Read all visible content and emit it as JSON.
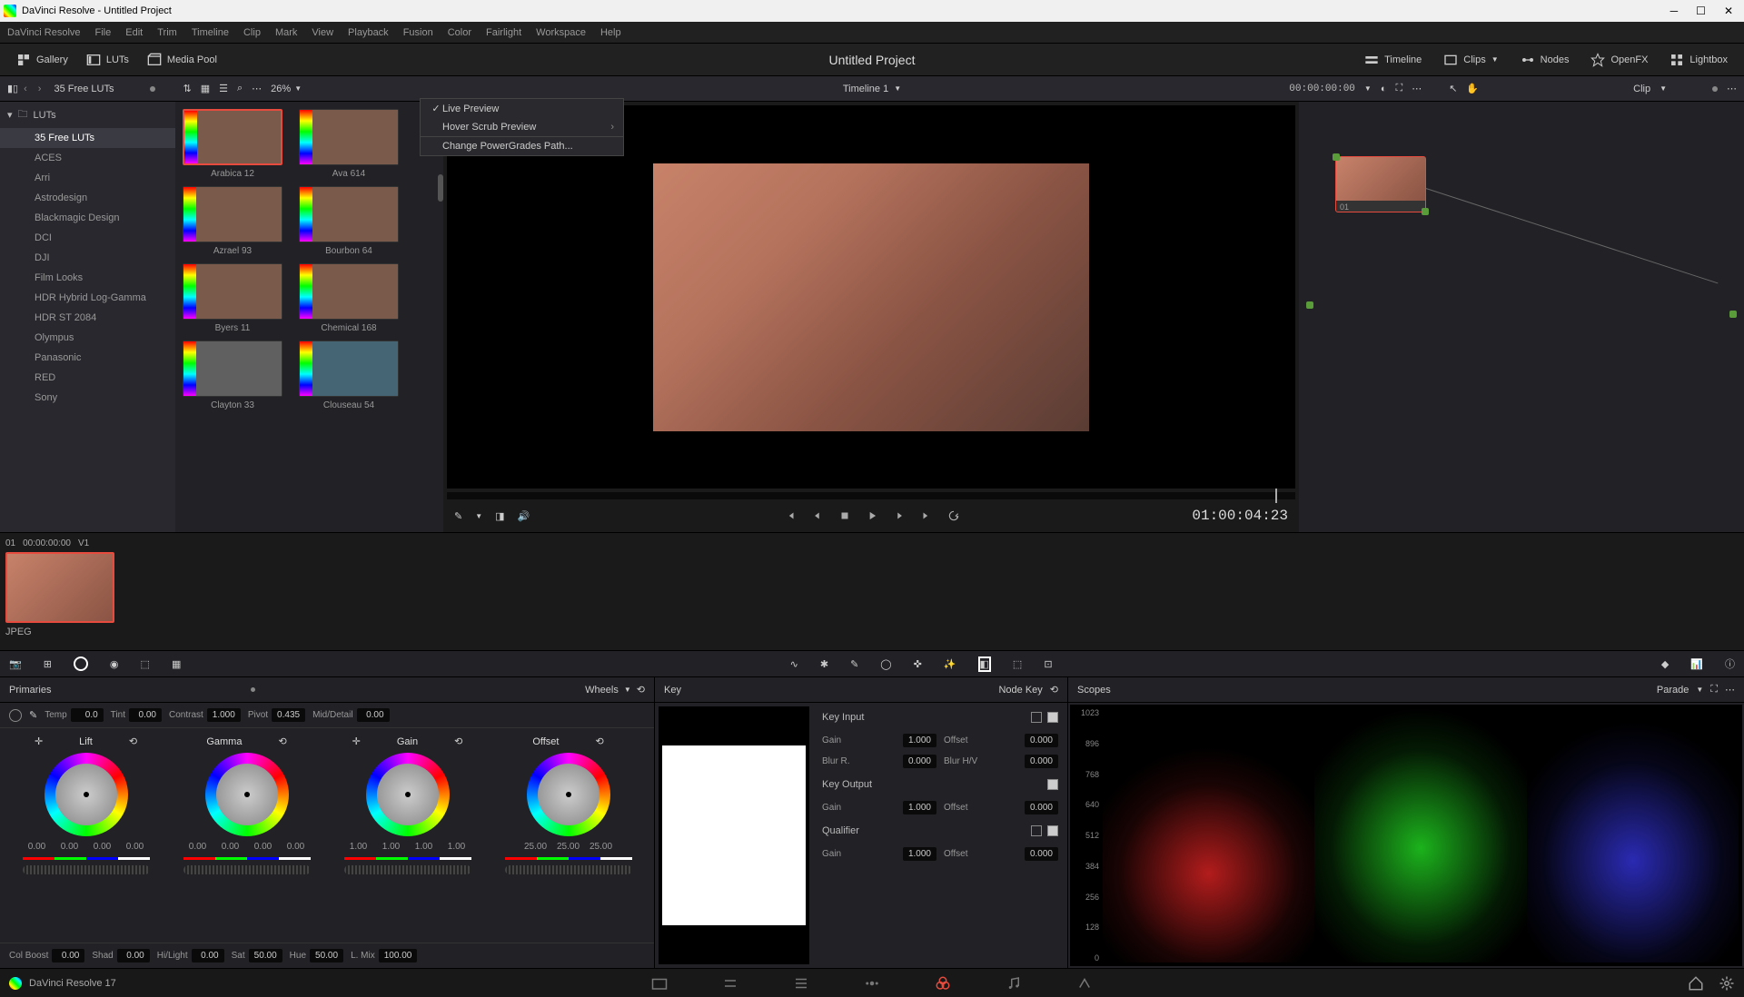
{
  "titlebar": {
    "app": "DaVinci Resolve",
    "project": "Untitled Project",
    "full": "DaVinci Resolve - Untitled Project"
  },
  "menubar": [
    "DaVinci Resolve",
    "File",
    "Edit",
    "Trim",
    "Timeline",
    "Clip",
    "Mark",
    "View",
    "Playback",
    "Fusion",
    "Color",
    "Fairlight",
    "Workspace",
    "Help"
  ],
  "toolbar": {
    "gallery": "Gallery",
    "luts": "LUTs",
    "mediapool": "Media Pool",
    "title": "Untitled Project",
    "timeline": "Timeline",
    "clips": "Clips",
    "nodes": "Nodes",
    "openfx": "OpenFX",
    "lightbox": "Lightbox"
  },
  "subtoolbar": {
    "path": "35 Free LUTs",
    "zoom": "26%",
    "timeline_name": "Timeline 1",
    "timecode": "00:00:00:00",
    "clip_mode": "Clip"
  },
  "context_menu": {
    "live_preview": "Live Preview",
    "hover_scrub": "Hover Scrub Preview",
    "change_path": "Change PowerGrades Path..."
  },
  "lut_tree": {
    "root": "LUTs",
    "items": [
      "35 Free LUTs",
      "ACES",
      "Arri",
      "Astrodesign",
      "Blackmagic Design",
      "DCI",
      "DJI",
      "Film Looks",
      "HDR Hybrid Log-Gamma",
      "HDR ST 2084",
      "Olympus",
      "Panasonic",
      "RED",
      "Sony"
    ],
    "active_index": 0
  },
  "lut_grid": [
    {
      "name": "Arabica 12",
      "selected": true
    },
    {
      "name": "Ava 614",
      "selected": false
    },
    {
      "name": "Azrael 93",
      "selected": false
    },
    {
      "name": "Bourbon 64",
      "selected": false
    },
    {
      "name": "Byers 11",
      "selected": false
    },
    {
      "name": "Chemical 168",
      "selected": false
    },
    {
      "name": "Clayton 33",
      "selected": false
    },
    {
      "name": "Clouseau 54",
      "selected": false
    }
  ],
  "viewer": {
    "tc": "01:00:04:23"
  },
  "nodes": {
    "node1_label": "01"
  },
  "clip": {
    "num": "01",
    "tc": "00:00:00:00",
    "track": "V1",
    "type": "JPEG"
  },
  "primaries": {
    "title": "Primaries",
    "mode": "Wheels",
    "params_top": {
      "temp_label": "Temp",
      "temp": "0.0",
      "tint_label": "Tint",
      "tint": "0.00",
      "contrast_label": "Contrast",
      "contrast": "1.000",
      "pivot_label": "Pivot",
      "pivot": "0.435",
      "mid_label": "Mid/Detail",
      "mid": "0.00"
    },
    "wheels": {
      "lift": {
        "name": "Lift",
        "vals": [
          "0.00",
          "0.00",
          "0.00",
          "0.00"
        ]
      },
      "gamma": {
        "name": "Gamma",
        "vals": [
          "0.00",
          "0.00",
          "0.00",
          "0.00"
        ]
      },
      "gain": {
        "name": "Gain",
        "vals": [
          "1.00",
          "1.00",
          "1.00",
          "1.00"
        ]
      },
      "offset": {
        "name": "Offset",
        "vals": [
          "25.00",
          "25.00",
          "25.00"
        ]
      }
    },
    "params_bottom": {
      "colboost_label": "Col Boost",
      "colboost": "0.00",
      "shad_label": "Shad",
      "shad": "0.00",
      "hilight_label": "Hi/Light",
      "hilight": "0.00",
      "sat_label": "Sat",
      "sat": "50.00",
      "hue_label": "Hue",
      "hue": "50.00",
      "lmix_label": "L. Mix",
      "lmix": "100.00"
    }
  },
  "key": {
    "title": "Key",
    "node_key": "Node Key",
    "key_input": "Key Input",
    "key_output": "Key Output",
    "qualifier": "Qualifier",
    "gain_label": "Gain",
    "offset_label": "Offset",
    "blur_r_label": "Blur R.",
    "blur_hv_label": "Blur H/V",
    "gain_val": "1.000",
    "offset_val": "0.000",
    "blur_r_val": "0.000",
    "blur_hv_val": "0.000"
  },
  "scopes": {
    "title": "Scopes",
    "mode": "Parade",
    "axis": [
      "1023",
      "896",
      "768",
      "640",
      "512",
      "384",
      "256",
      "128",
      "0"
    ]
  },
  "pagebar": {
    "version": "DaVinci Resolve 17"
  }
}
